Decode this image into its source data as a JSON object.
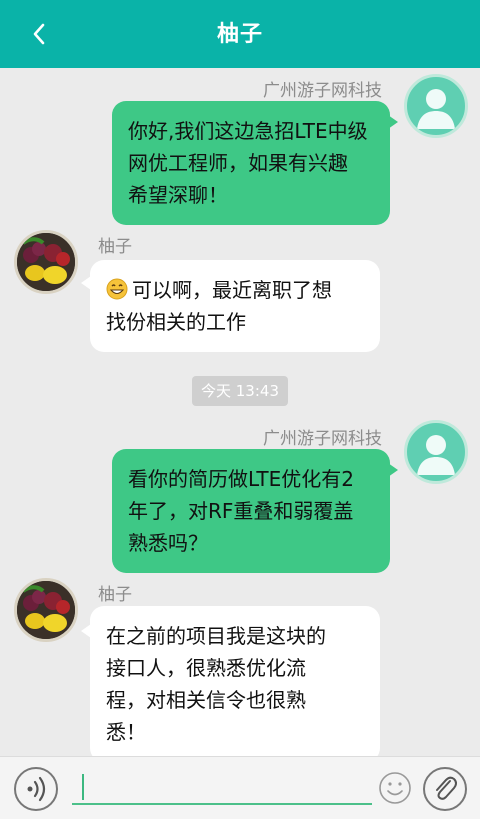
{
  "header": {
    "title": "柚子",
    "back_icon": "chevron-left-icon"
  },
  "colors": {
    "header_bg": "#0ab3a8",
    "sent_bubble": "#3ec886",
    "received_bubble": "#ffffff",
    "background": "#ebebeb"
  },
  "messages": [
    {
      "direction": "sent",
      "sender": "广州游子网科技",
      "lines": [
        "你好,我们这边急招LTE中级",
        "网优工程师，如果有兴趣",
        "希望深聊！"
      ]
    },
    {
      "direction": "received",
      "sender": "柚子",
      "emoji": "grin-emoji-icon",
      "lines": [
        "可以啊，最近离职了想",
        "找份相关的工作"
      ]
    },
    {
      "direction": "sent",
      "sender": "广州游子网科技",
      "lines": [
        "看你的简历做LTE优化有2",
        "年了，对RF重叠和弱覆盖",
        "熟悉吗？"
      ]
    },
    {
      "direction": "received",
      "sender": "柚子",
      "lines": [
        "在之前的项目我是这块的",
        "接口人，很熟悉优化流",
        "程，对相关信令也很熟",
        "悉！"
      ]
    }
  ],
  "timestamp": "今天  13:43",
  "input_bar": {
    "voice_icon": "voice-icon",
    "text_value": "",
    "emoji_icon": "smiley-icon",
    "attach_icon": "paperclip-icon"
  }
}
